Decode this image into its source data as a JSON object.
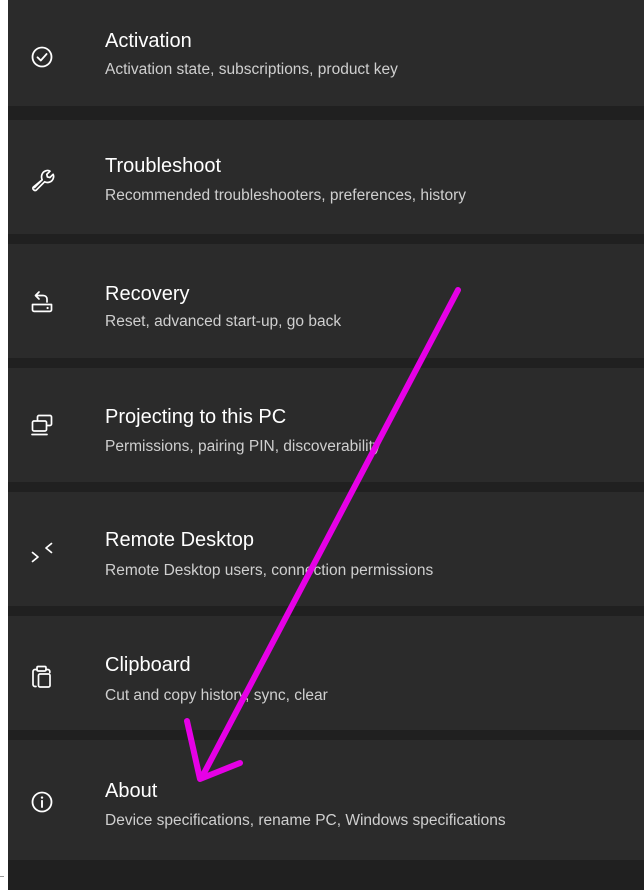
{
  "settings": {
    "items": [
      {
        "title": "Activation",
        "subtitle": "Activation state, subscriptions, product key",
        "icon": "checkmark-circle-icon"
      },
      {
        "title": "Troubleshoot",
        "subtitle": "Recommended troubleshooters, preferences, history",
        "icon": "wrench-icon"
      },
      {
        "title": "Recovery",
        "subtitle": "Reset, advanced start-up, go back",
        "icon": "recovery-icon"
      },
      {
        "title": "Projecting to this PC",
        "subtitle": "Permissions, pairing PIN, discoverability",
        "icon": "projecting-icon"
      },
      {
        "title": "Remote Desktop",
        "subtitle": "Remote Desktop users, connection permissions",
        "icon": "remote-desktop-icon"
      },
      {
        "title": "Clipboard",
        "subtitle": "Cut and copy history, sync, clear",
        "icon": "clipboard-icon"
      },
      {
        "title": "About",
        "subtitle": "Device specifications, rename PC, Windows specifications",
        "icon": "info-circle-icon"
      }
    ]
  },
  "colors": {
    "background": "#202020",
    "card": "#2b2b2b",
    "title": "#ffffff",
    "subtitle": "#cfcfcf",
    "annotation_arrow": "#e600e6"
  }
}
